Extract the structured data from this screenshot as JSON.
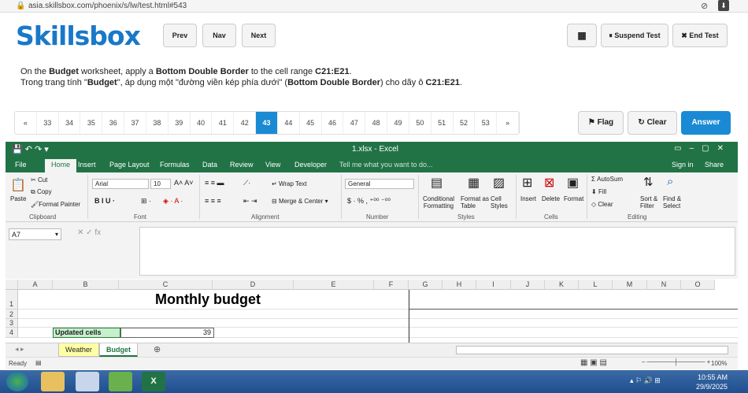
{
  "browser": {
    "url": "asia.skillsbox.com/phoenix/s/lw/test.html#543"
  },
  "test": {
    "logo": "Skillsbox",
    "prev_label": "Prev",
    "nav_label": "Nav",
    "next_label": "Next",
    "suspend_label": "Suspend Test",
    "end_label": "End Test",
    "question_en": {
      "p1": "On the ",
      "b1": "Budget",
      "p2": " worksheet, apply a ",
      "b2": "Bottom Double Border",
      "p3": " to the cell range ",
      "b3": "C21:E21",
      "p4": "."
    },
    "question_vi": {
      "p1": "Trong trang tính \"",
      "b1": "Budget",
      "p2": "\", áp dụng một \"đường viền kép phía dưới\" (",
      "b2": "Bottom Double Border",
      "p3": ") cho dãy ô ",
      "b3": "C21:E21",
      "p4": "."
    },
    "question_numbers": [
      "«",
      "33",
      "34",
      "35",
      "36",
      "37",
      "38",
      "39",
      "40",
      "41",
      "42",
      "43",
      "44",
      "45",
      "46",
      "47",
      "48",
      "49",
      "50",
      "51",
      "52",
      "53",
      "»"
    ],
    "current_question": "43",
    "flag_label": "Flag",
    "clear_label": "Clear",
    "answer_label": "Answer"
  },
  "excel": {
    "title": "1.xlsx - Excel",
    "tabs": [
      "File",
      "Home",
      "Insert",
      "Page Layout",
      "Formulas",
      "Data",
      "Review",
      "View",
      "Developer"
    ],
    "tell_me": "Tell me what you want to do...",
    "sign_in": "Sign in",
    "share": "Share",
    "ribbon": {
      "clipboard": {
        "label": "Clipboard",
        "paste": "Paste",
        "cut": "Cut",
        "copy": "Copy",
        "format_painter": "Format Painter"
      },
      "font": {
        "label": "Font",
        "name": "Arial",
        "size": "10"
      },
      "alignment": {
        "label": "Alignment",
        "wrap": "Wrap Text",
        "merge": "Merge & Center"
      },
      "number": {
        "label": "Number",
        "format": "General"
      },
      "styles": {
        "label": "Styles",
        "conditional": "Conditional",
        "conditional2": "Formatting",
        "format_as": "Format as",
        "format_as2": "Table",
        "cell": "Cell",
        "cell2": "Styles"
      },
      "cells": {
        "label": "Cells",
        "insert": "Insert",
        "delete": "Delete",
        "format": "Format"
      },
      "editing": {
        "label": "Editing",
        "autosum": "AutoSum",
        "fill": "Fill",
        "clear": "Clear",
        "sort": "Sort &",
        "sort2": "Filter",
        "find": "Find &",
        "find2": "Select"
      }
    },
    "namebox": "A7",
    "columns": [
      "A",
      "B",
      "C",
      "D",
      "E",
      "F",
      "G",
      "H",
      "I",
      "J",
      "K",
      "L",
      "M",
      "N",
      "O"
    ],
    "rows": [
      "1",
      "2",
      "3",
      "4"
    ],
    "sheet_title": "Monthly budget",
    "updated_label": "Updated cells",
    "updated_value": "39",
    "sheets": [
      "Weather",
      "Budget"
    ],
    "active_sheet": "Budget",
    "status_ready": "Ready",
    "zoom": "100%"
  },
  "taskbar": {
    "time": "10:55 AM",
    "date": "29/9/2025"
  }
}
